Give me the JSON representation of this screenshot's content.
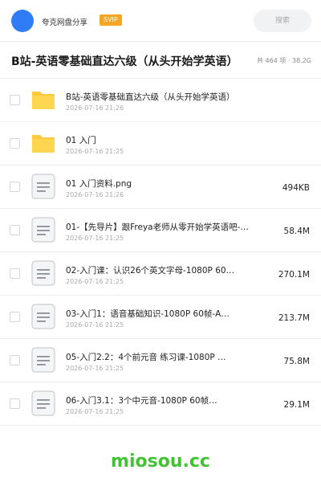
{
  "header": {
    "account_name": "夸克网盘分享",
    "vip_badge": "SVIP",
    "search_placeholder": "搜索"
  },
  "folder": {
    "title": "B站-英语零基础直达六级（从头开始学英语）",
    "meta": "共 464 项 · 38.2G"
  },
  "files": [
    {
      "name": "B站-英语零基础直达六级（从头开始学英语）",
      "date": "2026-07-16 21:26",
      "size": "",
      "type": "folder"
    },
    {
      "name": "01 入门",
      "date": "2026-07-16 21:25",
      "size": "",
      "type": "folder"
    },
    {
      "name": "01 入门资料.png",
      "date": "2026-07-16 21:26",
      "size": "494KB",
      "type": "file"
    },
    {
      "name": "01-【先导片】跟Freya老师从零开始学英语吧-…",
      "date": "2026-07-16 21:25",
      "size": "58.4M",
      "type": "file"
    },
    {
      "name": "02-入门课：认识26个英文字母-1080P 60…",
      "date": "2026-07-16 21:25",
      "size": "270.1M",
      "type": "file"
    },
    {
      "name": "03-入门1：语音基础知识-1080P 60帧-A…",
      "date": "2026-07-16 21:25",
      "size": "213.7M",
      "type": "file"
    },
    {
      "name": "05-入门2.2：4个前元音 练习课-1080P …",
      "date": "2026-07-16 21:25",
      "size": "75.8M",
      "type": "file"
    },
    {
      "name": "06-入门3.1：3个中元音-1080P 60帧…",
      "date": "2026-07-16 21:25",
      "size": "29.1M",
      "type": "file"
    }
  ],
  "watermark": "miosou.cc",
  "colors": {
    "avatar": "#2f7cf6",
    "vip": "#f5a623",
    "folder": "#ffc83d",
    "watermark": "#44c236"
  }
}
